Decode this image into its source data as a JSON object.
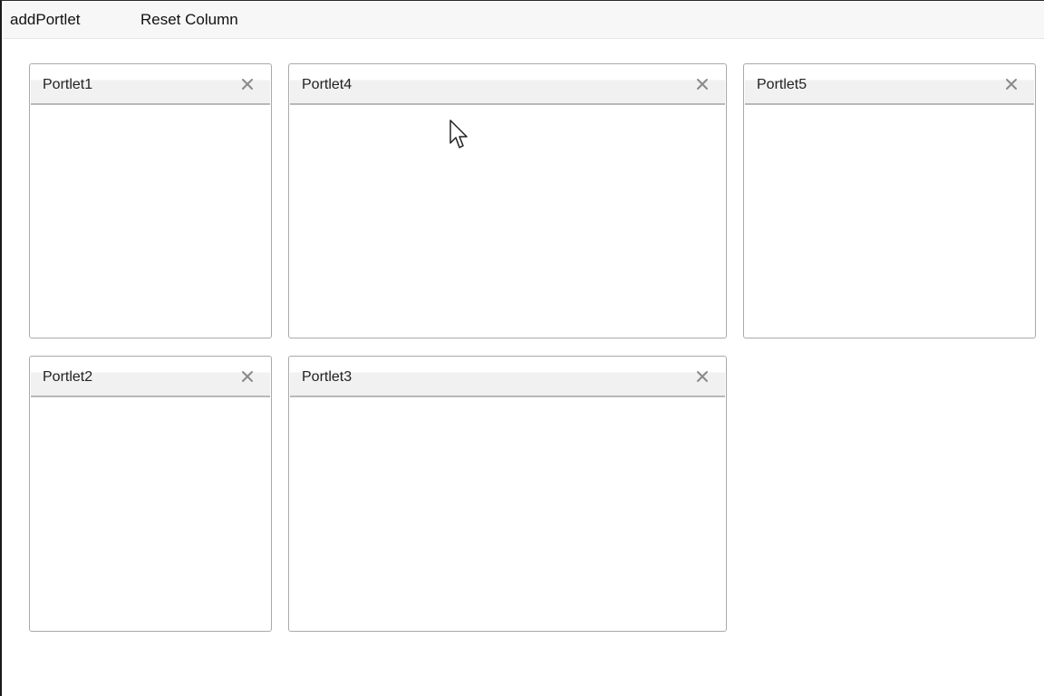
{
  "toolbar": {
    "add_portlet_label": "addPortlet",
    "reset_column_label": "Reset Column"
  },
  "portlets": [
    {
      "title": "Portlet1",
      "close_icon": "close-icon"
    },
    {
      "title": "Portlet4",
      "close_icon": "close-icon"
    },
    {
      "title": "Portlet5",
      "close_icon": "close-icon"
    },
    {
      "title": "Portlet2",
      "close_icon": "close-icon"
    },
    {
      "title": "Portlet3",
      "close_icon": "close-icon"
    }
  ],
  "colors": {
    "border": "#a9a9a9",
    "header_bg": "#f1f1f1",
    "close_icon": "#8a8a8a",
    "toolbar_bg": "#f7f7f7"
  },
  "cursor_icon": "arrow-cursor-icon"
}
